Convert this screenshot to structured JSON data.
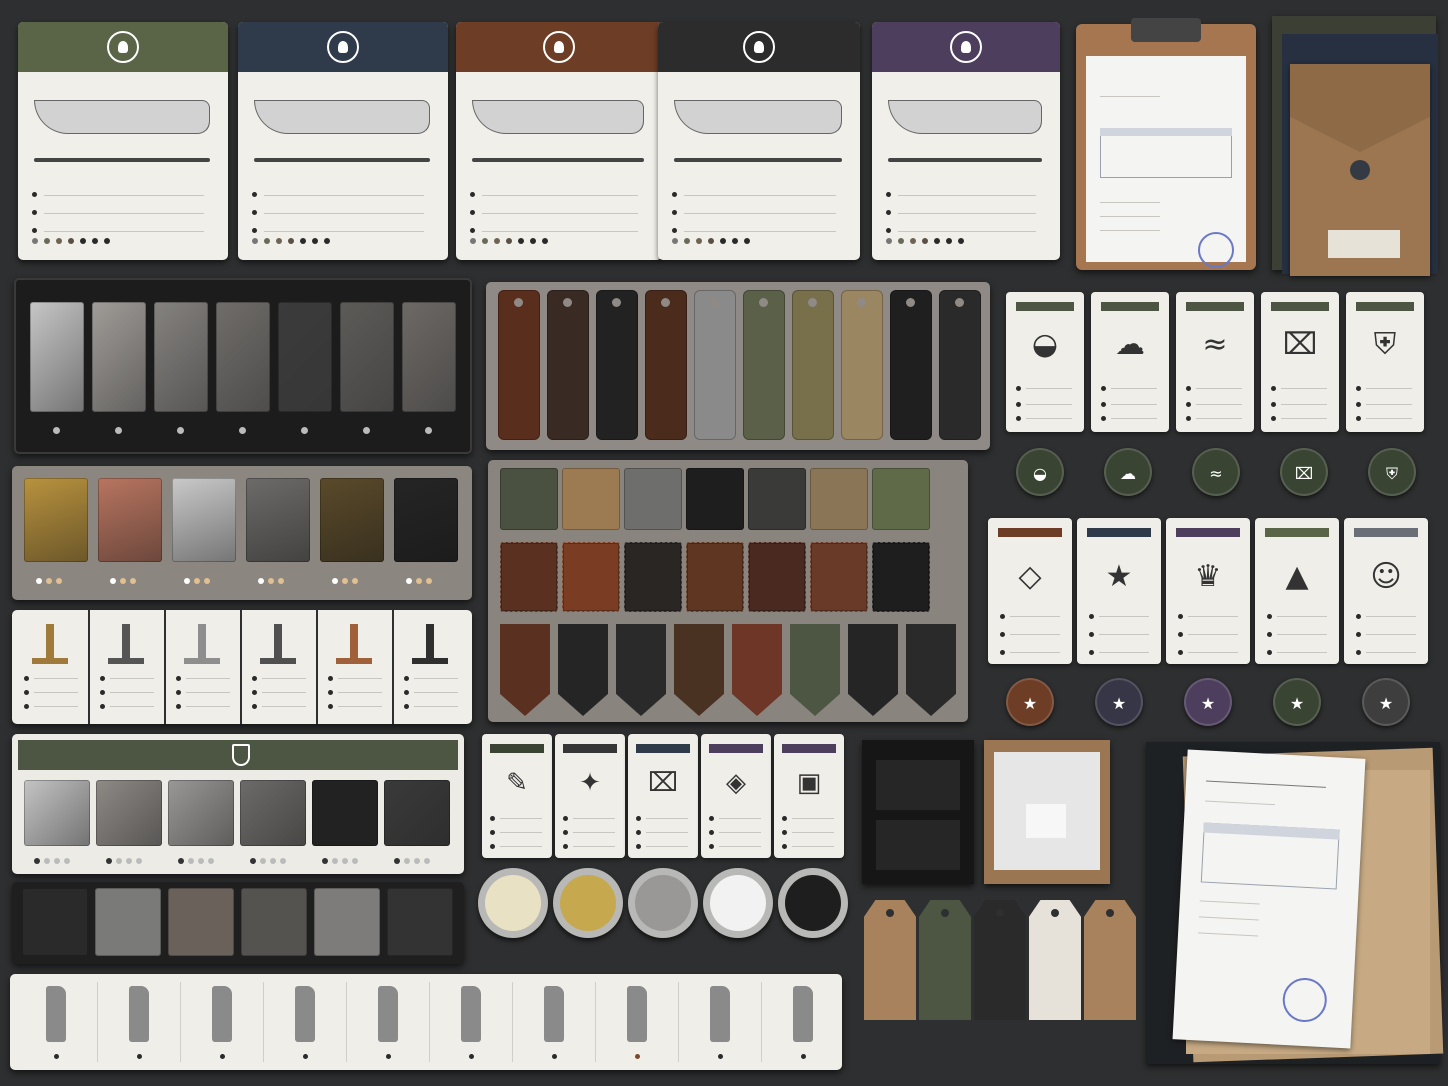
{
  "scene": {
    "description_free": true,
    "background": "#2e2f30"
  },
  "knife_cards": [
    {
      "color": "#5a6446",
      "icon": "shield-leaf-icon"
    },
    {
      "color": "#2f3a4b",
      "icon": "flame-icon"
    },
    {
      "color": "#6e3d25",
      "icon": "flame-icon"
    },
    {
      "color": "#2c2c2c",
      "icon": "flame-icon"
    },
    {
      "color": "#4c3e5c",
      "icon": "flame-icon"
    }
  ],
  "steel_finishes": [
    "#c6c6c6",
    "#a09c98",
    "#85827f",
    "#706d6a",
    "#3b3b3c",
    "#5d5b58",
    "#6d6966"
  ],
  "handle_scales": [
    "#5a2e1d",
    "#3a2a24",
    "#222222",
    "#4a2b1c",
    "#8a8a8a",
    "#5a6148",
    "#77704a",
    "#9a8660",
    "#1f1f1f",
    "#2a2a2a"
  ],
  "metal_plates": [
    "#b8923e",
    "#b87560",
    "#c9c9c9",
    "#6c6b69",
    "#5a4a2a",
    "#252525"
  ],
  "guard_colors": [
    "#a07a3a",
    "#555555",
    "#8e8e8e",
    "#505050",
    "#a0603a",
    "#2f2f2f"
  ],
  "care_icons": [
    "drop-icon",
    "rain-icon",
    "waves-icon",
    "spray-bottle-icon",
    "shield-icon"
  ],
  "care_discs": [
    "#3a4433",
    "#3a4433",
    "#3a4433",
    "#3a4433",
    "#3a4433"
  ],
  "quality_cards": [
    {
      "bar": "#6e3d25",
      "icon": "diamond-icon"
    },
    {
      "bar": "#2f3a4b",
      "icon": "star-icon"
    },
    {
      "bar": "#4c3e5c",
      "icon": "crown-icon"
    },
    {
      "bar": "#5a6446",
      "icon": "weight-icon"
    },
    {
      "bar": "#6a6e76",
      "icon": "team-icon"
    }
  ],
  "star_discs": [
    "#6e3d25",
    "#363646",
    "#4c3e5c",
    "#3a4433",
    "#3e3e3e"
  ],
  "leather_row1": [
    "#4a5140",
    "#9c7a52",
    "#6e6e6c",
    "#1e1e1e",
    "#3a3a38",
    "#8a7656",
    "#5f6a48"
  ],
  "leather_row2": [
    "#5a3020",
    "#7a3c22",
    "#2a2624",
    "#5e3622",
    "#4a2a20",
    "#6a3a28",
    "#1e1e1e"
  ],
  "leather_row3": [
    "#5a3020",
    "#252525",
    "#2a2a2a",
    "#4a3222",
    "#6e3626",
    "#4c5642",
    "#252525",
    "#2a2a2a"
  ],
  "finish_samples": [
    "#c4c4c4",
    "#8e8a86",
    "#9a9896",
    "#6d6b69",
    "#222222",
    "#3a3a3a"
  ],
  "stone_samples": [
    "#2a2a2a",
    "#7a7a78",
    "#6a625a",
    "#555350",
    "#7e7c7a",
    "#333333"
  ],
  "maintenance_icons": [
    "brush-icon",
    "sparkle-icon",
    "spray-icon",
    "cloth-icon",
    "box-icon"
  ],
  "maintenance_bars": [
    "#3a4433",
    "#363636",
    "#2f3a4b",
    "#4c3e5c",
    "#4c3e5c"
  ],
  "tins": [
    "#e9e1c4",
    "#c6a84e",
    "#9a9896",
    "#f2f2f2",
    "#1e1e1e"
  ],
  "tags": [
    "#a8825c",
    "#4c5642",
    "#2a2a2a",
    "#e6e2da",
    "#a8825c"
  ],
  "profiles_count_visible": 10
}
